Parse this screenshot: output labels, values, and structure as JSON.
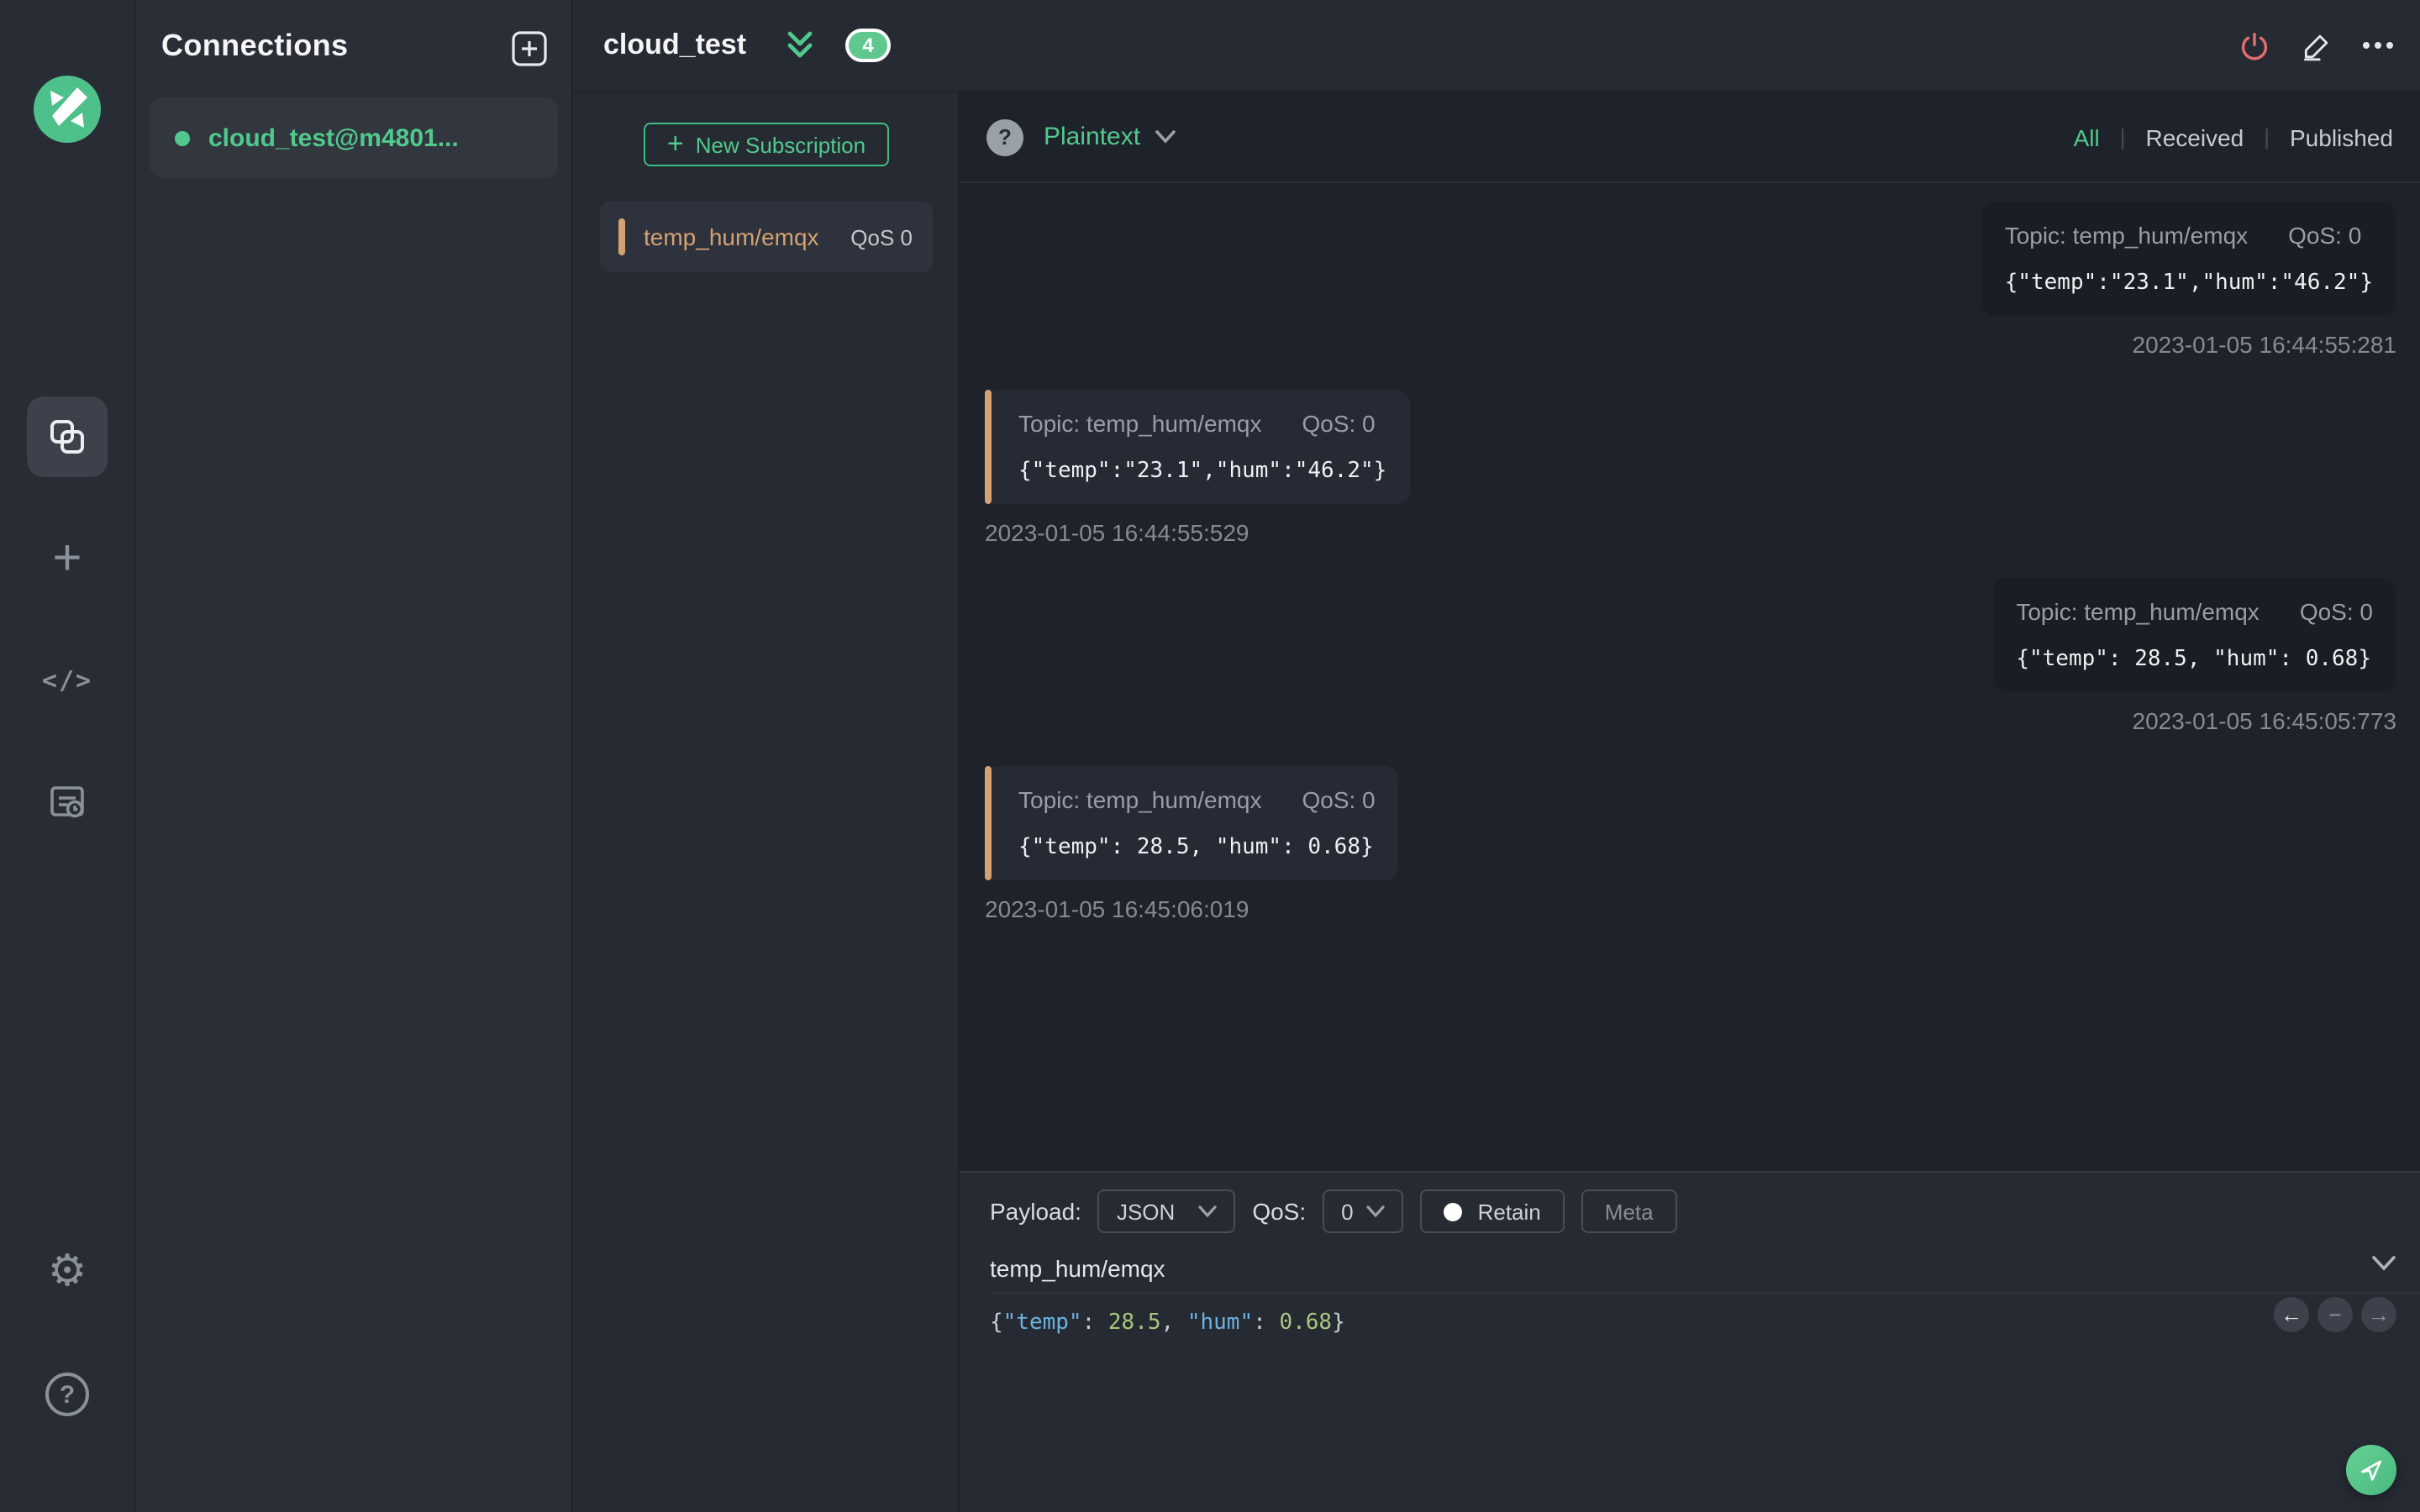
{
  "colors": {
    "accent_green": "#52c98c",
    "accent_orange": "#d4a272",
    "danger_red": "#e26d6d"
  },
  "glyphs": {
    "plus": "+",
    "code": "</>",
    "gear": "⚙",
    "help": "?",
    "format_help": "?",
    "arrow_left": "←",
    "minus": "−",
    "arrow_right": "→"
  },
  "connections_panel": {
    "title": "Connections",
    "items": [
      {
        "label": "cloud_test@m4801...",
        "status": "connected"
      }
    ]
  },
  "header": {
    "title": "cloud_test",
    "badge_count": "4"
  },
  "subscriptions": {
    "new_button_label": "New Subscription",
    "items": [
      {
        "topic": "temp_hum/emqx",
        "qos": "QoS 0"
      }
    ]
  },
  "messages_toolbar": {
    "format": "Plaintext",
    "filters": [
      {
        "label": "All",
        "active": true
      },
      {
        "label": "Received",
        "active": false
      },
      {
        "label": "Published",
        "active": false
      }
    ]
  },
  "messages": [
    {
      "direction": "published",
      "topic": "Topic: temp_hum/emqx",
      "qos": "QoS: 0",
      "payload": "{\"temp\":\"23.1\",\"hum\":\"46.2\"}",
      "timestamp": "2023-01-05 16:44:55:281"
    },
    {
      "direction": "received",
      "topic": "Topic: temp_hum/emqx",
      "qos": "QoS: 0",
      "payload": "{\"temp\":\"23.1\",\"hum\":\"46.2\"}",
      "timestamp": "2023-01-05 16:44:55:529"
    },
    {
      "direction": "published",
      "topic": "Topic: temp_hum/emqx",
      "qos": "QoS: 0",
      "payload": "{\"temp\": 28.5, \"hum\": 0.68}",
      "timestamp": "2023-01-05 16:45:05:773"
    },
    {
      "direction": "received",
      "topic": "Topic: temp_hum/emqx",
      "qos": "QoS: 0",
      "payload": "{\"temp\": 28.5, \"hum\": 0.68}",
      "timestamp": "2023-01-05 16:45:06:019"
    }
  ],
  "composer": {
    "payload_label": "Payload:",
    "format_value": "JSON",
    "qos_label": "QoS:",
    "qos_value": "0",
    "retain_label": "Retain",
    "meta_label": "Meta",
    "topic_value": "temp_hum/emqx",
    "editor_segments": [
      {
        "text": "{",
        "type": "punct"
      },
      {
        "text": "\"temp\"",
        "type": "key"
      },
      {
        "text": ": ",
        "type": "punct"
      },
      {
        "text": "28.5",
        "type": "number"
      },
      {
        "text": ", ",
        "type": "punct"
      },
      {
        "text": "\"hum\"",
        "type": "key"
      },
      {
        "text": ": ",
        "type": "punct"
      },
      {
        "text": "0.68",
        "type": "number"
      },
      {
        "text": "}",
        "type": "punct"
      }
    ]
  }
}
